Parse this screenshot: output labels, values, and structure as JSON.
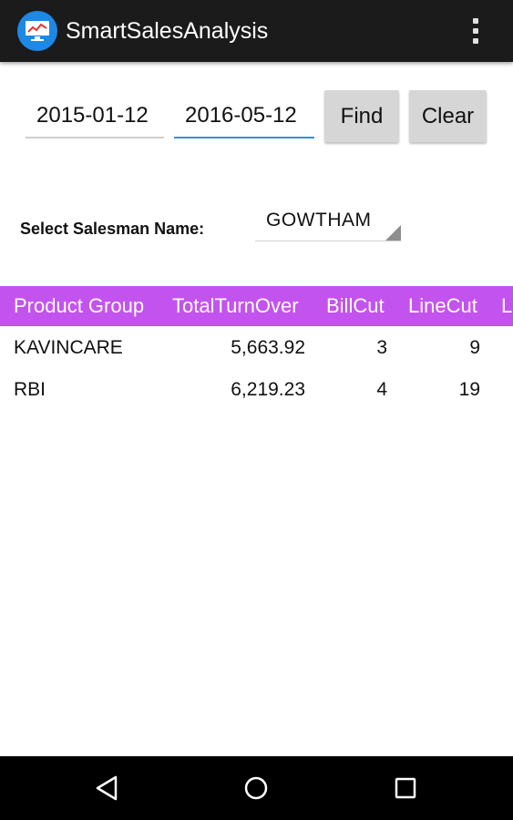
{
  "app": {
    "title": "SmartSalesAnalysis",
    "icon": "chart-monitor-icon"
  },
  "filters": {
    "from_date": "2015-01-12",
    "to_date": "2016-05-12",
    "find_label": "Find",
    "clear_label": "Clear",
    "salesman_label": "Select Salesman Name:",
    "salesman_value": "GOWTHAM"
  },
  "table": {
    "headers": [
      "Product Group",
      "TotalTurnOver",
      "BillCut",
      "LineCut",
      "L"
    ],
    "rows": [
      {
        "group": "KAVINCARE",
        "turnover": "5,663.92",
        "billcut": "3",
        "linecut": "9"
      },
      {
        "group": "RBI",
        "turnover": "6,219.23",
        "billcut": "4",
        "linecut": "19"
      }
    ]
  },
  "colors": {
    "appbar": "#1b1b1b",
    "table_header": "#c353ee",
    "active_underline": "#3b8fd6"
  },
  "nav": {
    "back": "back-triangle-icon",
    "home": "home-circle-icon",
    "recents": "recents-square-icon"
  }
}
